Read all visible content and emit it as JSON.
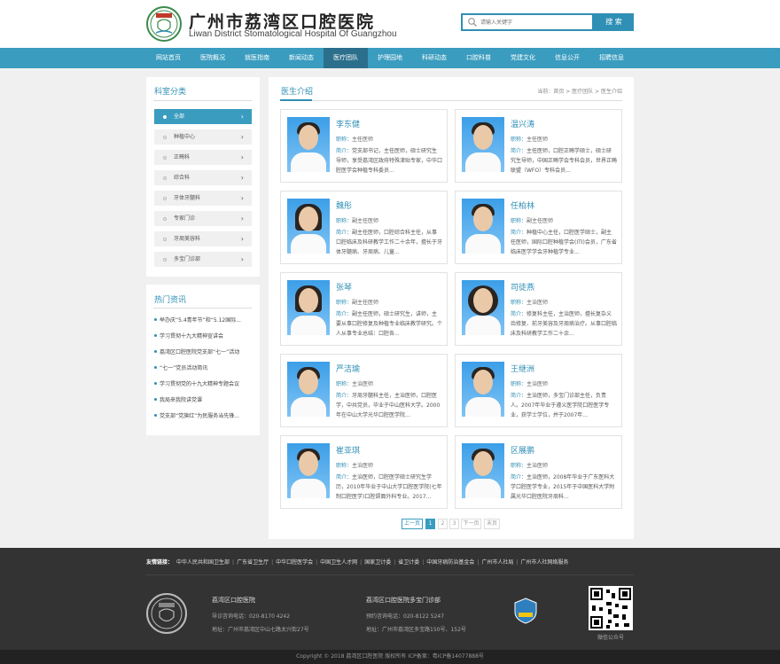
{
  "header": {
    "logo_title": "广州市荔湾区口腔医院",
    "logo_subtitle": "Liwan District Stomatological Hospital Of Guangzhou",
    "search_placeholder": "请输入关键字",
    "search_button": "搜 索"
  },
  "nav": [
    "网站首页",
    "医院概况",
    "就医指南",
    "新闻动态",
    "医疗团队",
    "护理园地",
    "科研动态",
    "口腔科普",
    "党建文化",
    "信息公开",
    "招聘信息"
  ],
  "nav_active_index": 4,
  "sidebar": {
    "category_title": "科室分类",
    "categories": [
      "全部",
      "种植中心",
      "正畸科",
      "综合科",
      "牙体牙髓科",
      "专家门诊",
      "牙周美容科",
      "多宝门诊部"
    ],
    "active_category_index": 0,
    "news_title": "热门资讯",
    "news": [
      "举办庆“5.4青年节”和“5.12国际...",
      "学习贯彻十九大精神宣讲会",
      "荔湾区口腔医院党支部“七一”活动",
      "“七一”党员活动简讯",
      "学习贯彻党的十九大精神专题会议",
      "我局来我院讲党课",
      "党支部“党旗红”为民服务当先锋..."
    ]
  },
  "main": {
    "title": "医生介绍",
    "breadcrumb": "当前：首页 > 医疗团队 > 医生介绍",
    "title_key": "职称：",
    "intro_key": "简介：",
    "doctors": [
      {
        "name": "李东健",
        "title": "主任医师",
        "intro": "党支部书记，主任医师，硕士研究生导师，享受荔湾区政府特殊津贴专家，中华口腔医学会种植专科委员..."
      },
      {
        "name": "温兴涛",
        "title": "主任医师",
        "intro": "主任医师，口腔正畸学硕士，硕士研究生导师，中国正畸学会专科会员，世界正畸联盟（WFO）专科会员..."
      },
      {
        "name": "魏彤",
        "title": "副主任医师",
        "intro": "副主任医师，口腔综合科主任，从事口腔临床及科研教学工作二十余年，擅长于牙体牙髓病、牙周病、儿童..."
      },
      {
        "name": "任柏林",
        "title": "副主任医师",
        "intro": "种植中心主任，口腔医学硕士，副主任医师，国际口腔种植学会(ITI)会员，广东省临床医学学会牙种植学专业..."
      },
      {
        "name": "张琴",
        "title": "副主任医师",
        "intro": "副主任医师，硕士研究生，讲师，主要从事口腔修复及种植专业临床教学研究。个人从事专业总结：口腔各..."
      },
      {
        "name": "司徒燕",
        "title": "主治医师",
        "intro": "修复科主任，主治医师，擅长复杂义齿修复、前牙美容及牙周病治疗。从事口腔临床及科研教学工作二十余..."
      },
      {
        "name": "严洁瑜",
        "title": "主治医师",
        "intro": "牙周牙髓科主任，主治医师，口腔医学，中共党员，毕业于中山医科大学。2000年在中山大学光华口腔医学院..."
      },
      {
        "name": "王继洲",
        "title": "主治医师",
        "intro": "主治医师，多宝门诊部主任，负责人。2007年毕业于遵义医学院口腔医学专业，获学士学位，并于2007年..."
      },
      {
        "name": "崔亚琪",
        "title": "主治医师",
        "intro": "主治医师，口腔医学硕士研究生学历，2010年毕业于中山大学口腔医学院(七年制口腔医学)口腔颌面外科专业。2017..."
      },
      {
        "name": "区展鹏",
        "title": "主治医师",
        "intro": "主治医师，2008年毕业于广东医科大学口腔医学专业，2015年于中国医科大学附属光华口腔医院牙周科..."
      }
    ]
  },
  "pagination": {
    "prev": "上一页",
    "pages": [
      "1",
      "2",
      "3"
    ],
    "active_page": "1",
    "next": "下一页",
    "last": "末页"
  },
  "footer": {
    "links_label": "友情链接：",
    "links": [
      "中华人民共和国卫生部",
      "广东省卫生厅",
      "中华口腔医学会",
      "中国卫生人才网",
      "国家卫计委",
      "省卫计委",
      "中国牙病防治基金会",
      "广州市人社局",
      "广州市人社网络服务"
    ],
    "col1": {
      "heading": "荔湾区口腔医院",
      "phone": "导诊咨询电话：020-8170 4242",
      "address": "地址：广州市荔湾区中山七路太兴街27号"
    },
    "col2": {
      "heading": "荔湾区口腔医院多宝门诊部",
      "phone": "预约咨询电话：020-8122 5247",
      "address": "地址：广州市荔湾区多宝路150号、152号"
    },
    "qr_label": "微信公众号",
    "copyright": "Copyright © 2018 荔湾区口腔医院 版权所有   ICP备案：粤ICP备14077888号"
  },
  "colors": {
    "accent": "#2f8fb5",
    "nav": "#3a9cbf",
    "nav_active": "#2b6f8c",
    "footer": "#333333"
  }
}
